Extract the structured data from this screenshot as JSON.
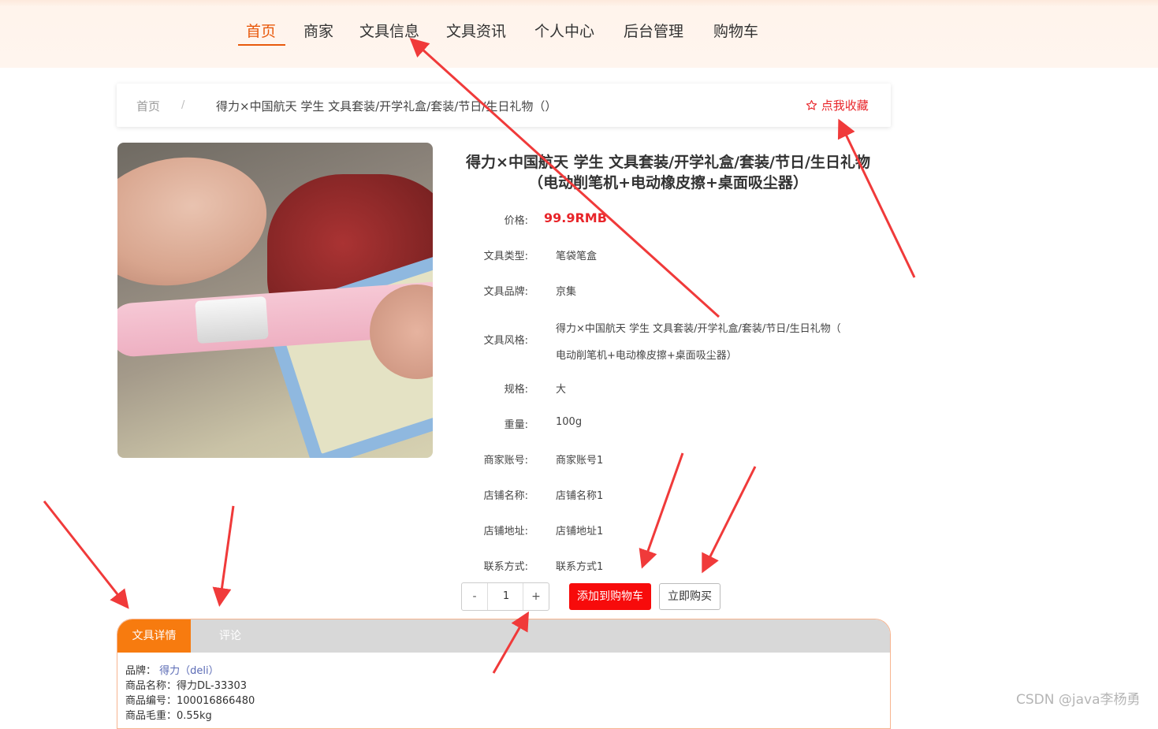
{
  "nav": {
    "items": [
      {
        "label": "首页",
        "active": true
      },
      {
        "label": "商家"
      },
      {
        "label": "文具信息"
      },
      {
        "label": "文具资讯"
      },
      {
        "label": "个人中心"
      },
      {
        "label": "后台管理"
      },
      {
        "label": "购物车"
      }
    ],
    "accent_color": "#e8590c"
  },
  "breadcrumb": {
    "home": "首页",
    "separator": "/",
    "current": "得力×中国航天 学生 文具套装/开学礼盒/套装/节日/生日礼物（）",
    "favorite_icon": "star-outline-icon",
    "favorite_label": "点我收藏"
  },
  "product": {
    "title_line1": "得力×中国航天 学生 文具套装/开学礼盒/套装/节日/生日礼物",
    "title_line2": "（电动削笔机+电动橡皮擦+桌面吸尘器）",
    "price_label": "价格:",
    "price_value": "99.9RMB",
    "type_label": "文具类型:",
    "type_value": "笔袋笔盒",
    "brand_label": "文具品牌:",
    "brand_value": "京集",
    "style_label": "文具风格:",
    "style_value_line1": "得力×中国航天 学生 文具套装/开学礼盒/套装/节日/生日礼物（",
    "style_value_line2": "电动削笔机+电动橡皮擦+桌面吸尘器）",
    "spec_label": "规格:",
    "spec_value": "大",
    "weight_label": "重量:",
    "weight_value": "100g",
    "merchant_account_label": "商家账号:",
    "merchant_account_value": "商家账号1",
    "shop_name_label": "店铺名称:",
    "shop_name_value": "店铺名称1",
    "shop_address_label": "店铺地址:",
    "shop_address_value": "店铺地址1",
    "contact_label": "联系方式:",
    "contact_value": "联系方式1",
    "price_color": "#e8252a"
  },
  "purchase": {
    "minus": "-",
    "quantity": "1",
    "plus": "+",
    "add_to_cart": "添加到购物车",
    "buy_now": "立即购买",
    "cart_button_color": "#f70b0b"
  },
  "tabs": {
    "details": "文具详情",
    "comments": "评论",
    "active_color": "#f77b0f"
  },
  "details": {
    "brand_label": "品牌：",
    "brand_value": "得力（deli）",
    "name_line": "商品名称：得力DL-33303",
    "code_line": "商品编号：100016866480",
    "weight_line": "商品毛重：0.55kg"
  },
  "watermark": "CSDN @java李杨勇"
}
